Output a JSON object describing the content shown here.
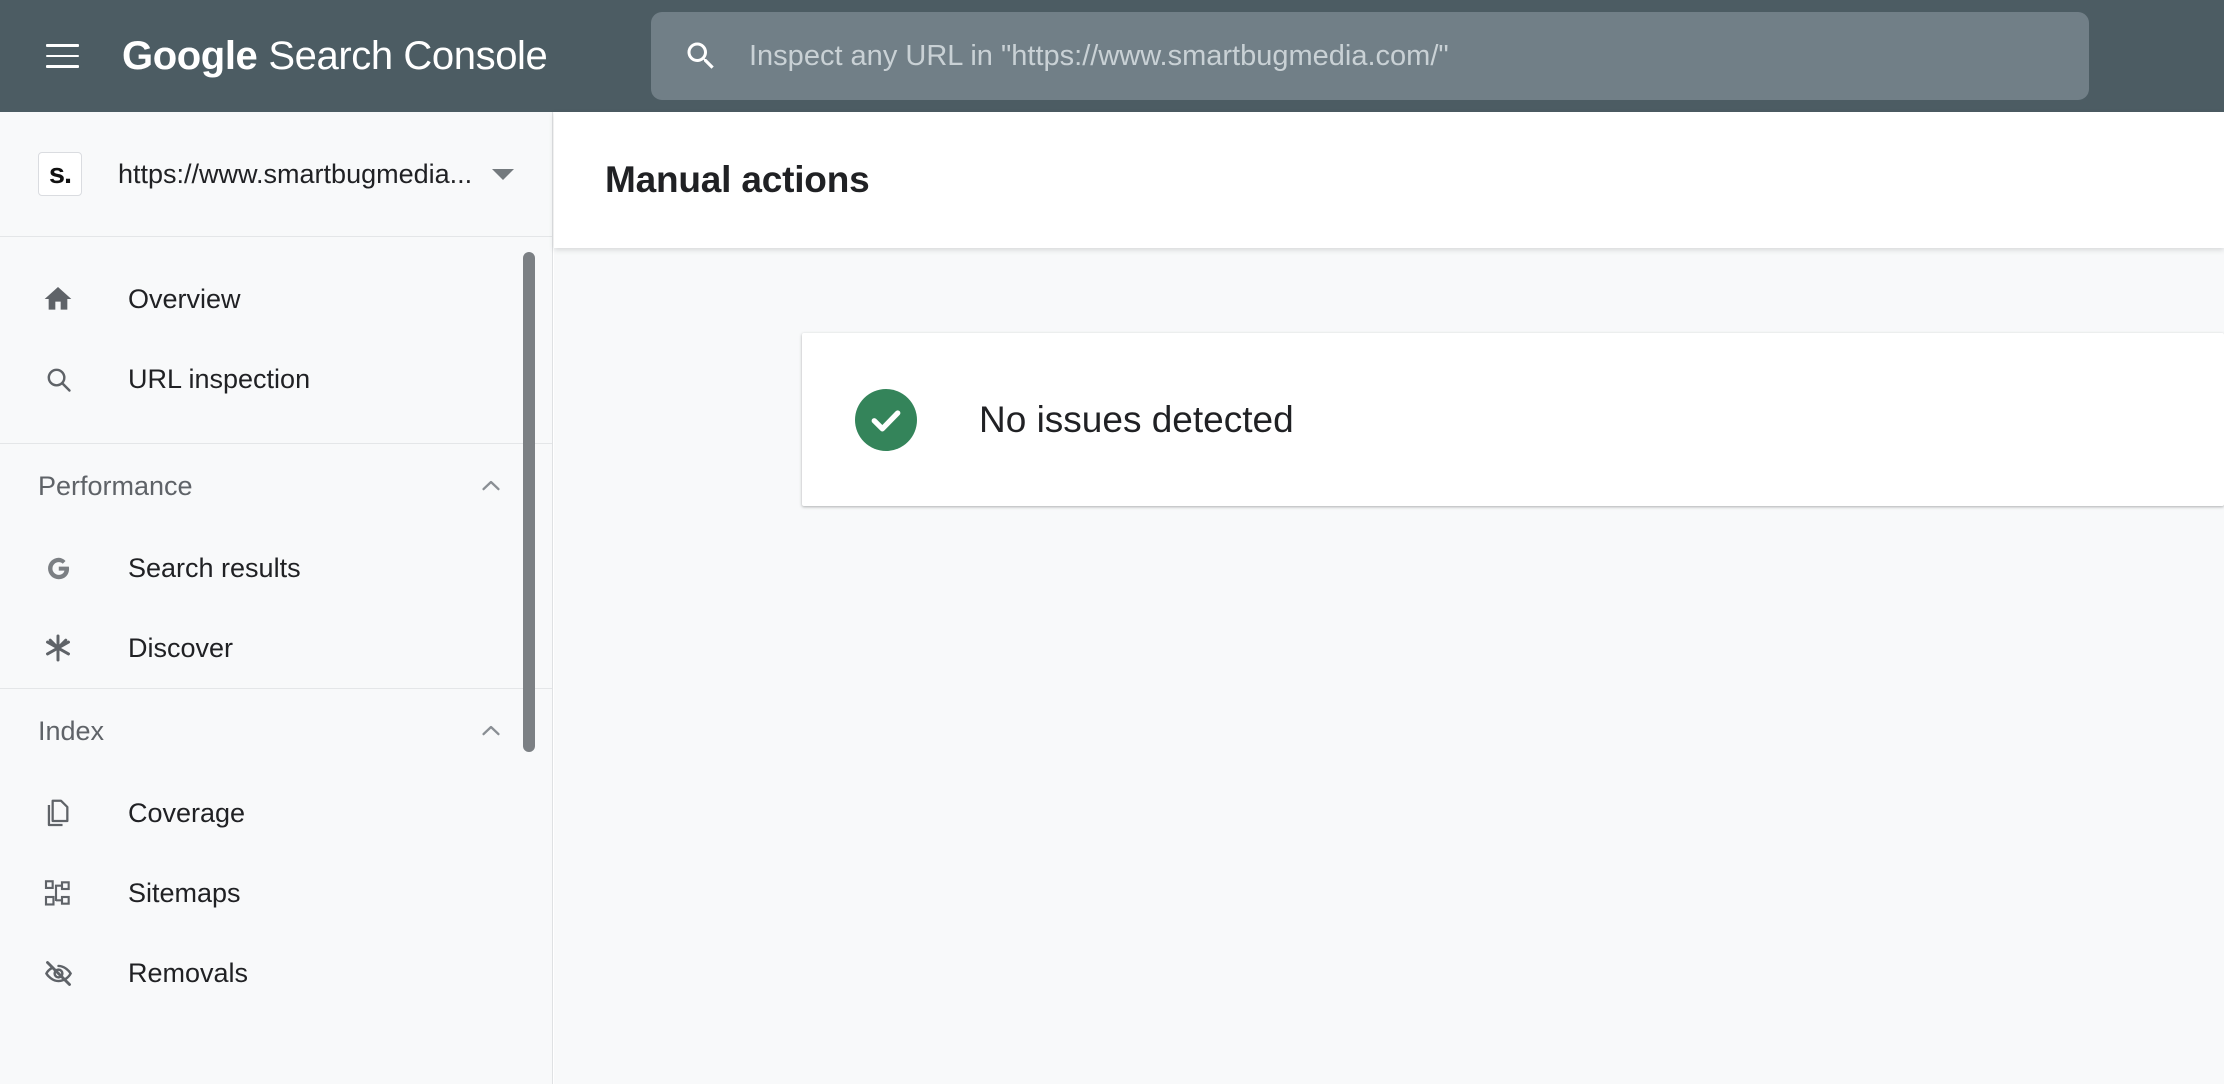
{
  "header": {
    "menu_icon": "hamburger-menu-icon",
    "brand_primary": "Google",
    "brand_secondary": "Search Console",
    "search": {
      "icon": "search-icon",
      "placeholder": "Inspect any URL in \"https://www.smartbugmedia.com/\"",
      "value": ""
    }
  },
  "sidebar": {
    "property": {
      "favicon_text": "s.",
      "name": "https://www.smartbugmedia....",
      "dropdown_icon": "triangle-down-icon"
    },
    "top_items": [
      {
        "label": "Overview",
        "icon": "home-icon"
      },
      {
        "label": "URL inspection",
        "icon": "search-icon"
      }
    ],
    "sections": [
      {
        "title": "Performance",
        "collapse_icon": "chevron-up-icon",
        "items": [
          {
            "label": "Search results",
            "icon": "google-g-icon"
          },
          {
            "label": "Discover",
            "icon": "discover-asterisk-icon"
          }
        ]
      },
      {
        "title": "Index",
        "collapse_icon": "chevron-up-icon",
        "items": [
          {
            "label": "Coverage",
            "icon": "pages-copy-icon"
          },
          {
            "label": "Sitemaps",
            "icon": "sitemap-hierarchy-icon"
          },
          {
            "label": "Removals",
            "icon": "eye-off-icon"
          }
        ]
      }
    ]
  },
  "main": {
    "page_title": "Manual actions",
    "status_card": {
      "icon": "check-circle-icon",
      "text": "No issues detected",
      "icon_color": "#34845a"
    }
  },
  "colors": {
    "header_bg": "#4c5c63",
    "search_bg": "#717f87",
    "sidebar_bg": "#f8f9fa",
    "success_green": "#34845a",
    "text_primary": "#202124",
    "text_secondary": "#5f6368"
  }
}
